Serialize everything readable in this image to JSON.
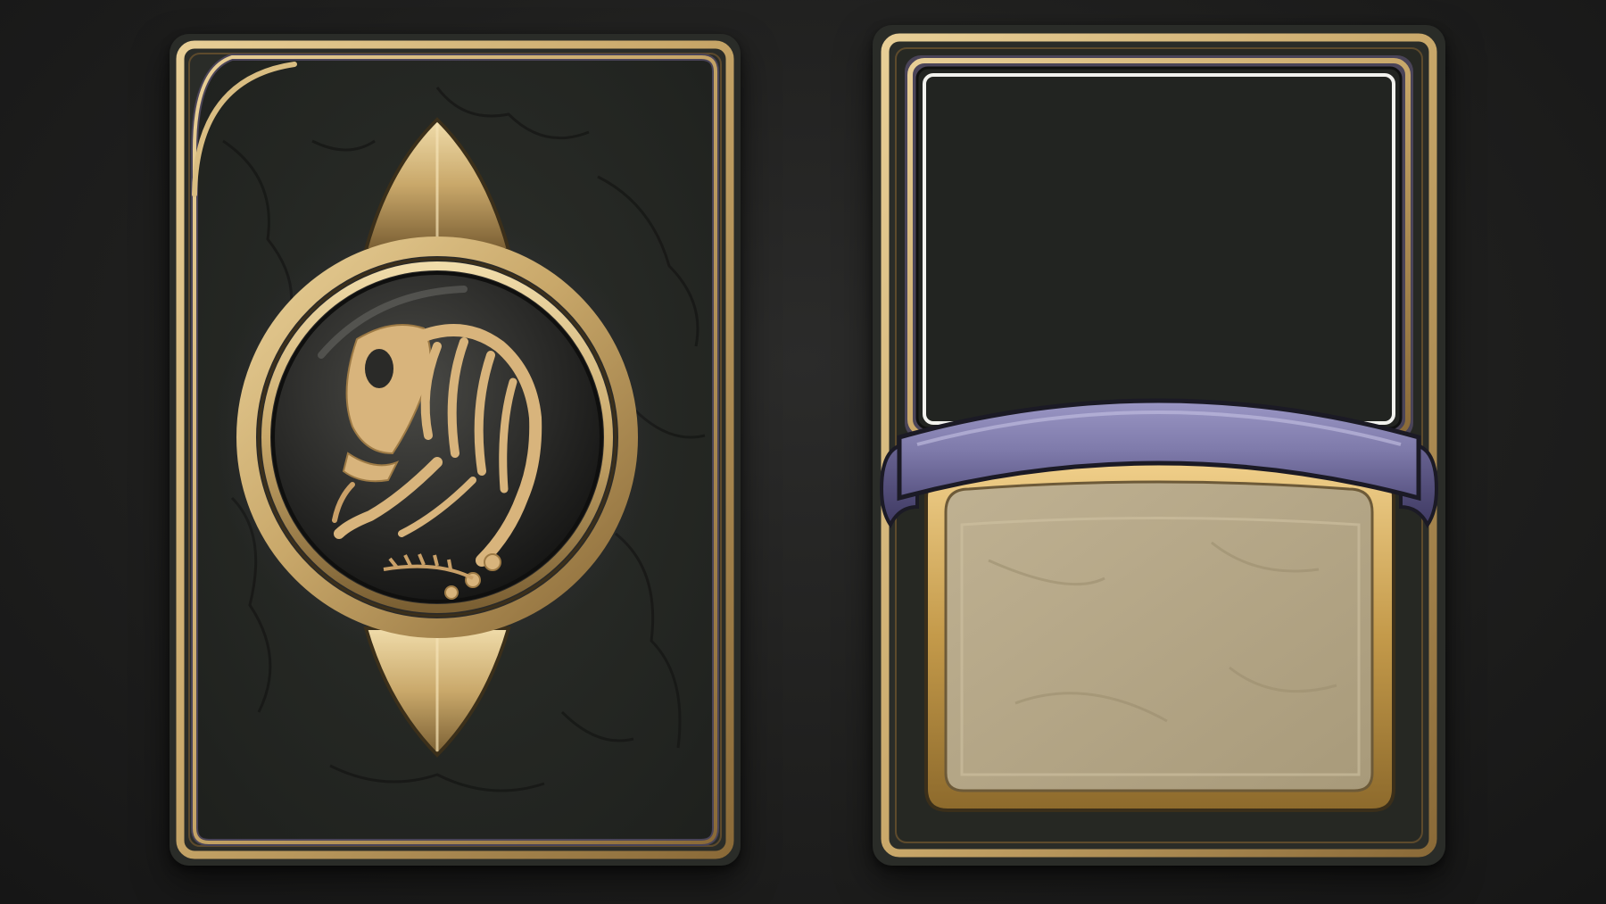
{
  "scene": {
    "background_color": "#1f1f1e",
    "cards": [
      {
        "id": "card-back",
        "kind": "card back",
        "emblem_icon": "fossil-skeleton-icon",
        "colors": {
          "body": "#262824",
          "gold": "#c9a86a",
          "gold_dark": "#7a5f33",
          "shadow_purple": "#4a4458",
          "orb": "#2a2a28"
        }
      },
      {
        "id": "card-front",
        "kind": "blank card frame",
        "colors": {
          "body": "#2a2c28",
          "gold": "#c9a86a",
          "art_window": "#222421",
          "banner": "#7f7bab",
          "banner_dark": "#4f4a78",
          "text_panel": "#b3a585",
          "text_panel_frame": "#c49a4a"
        }
      }
    ]
  }
}
